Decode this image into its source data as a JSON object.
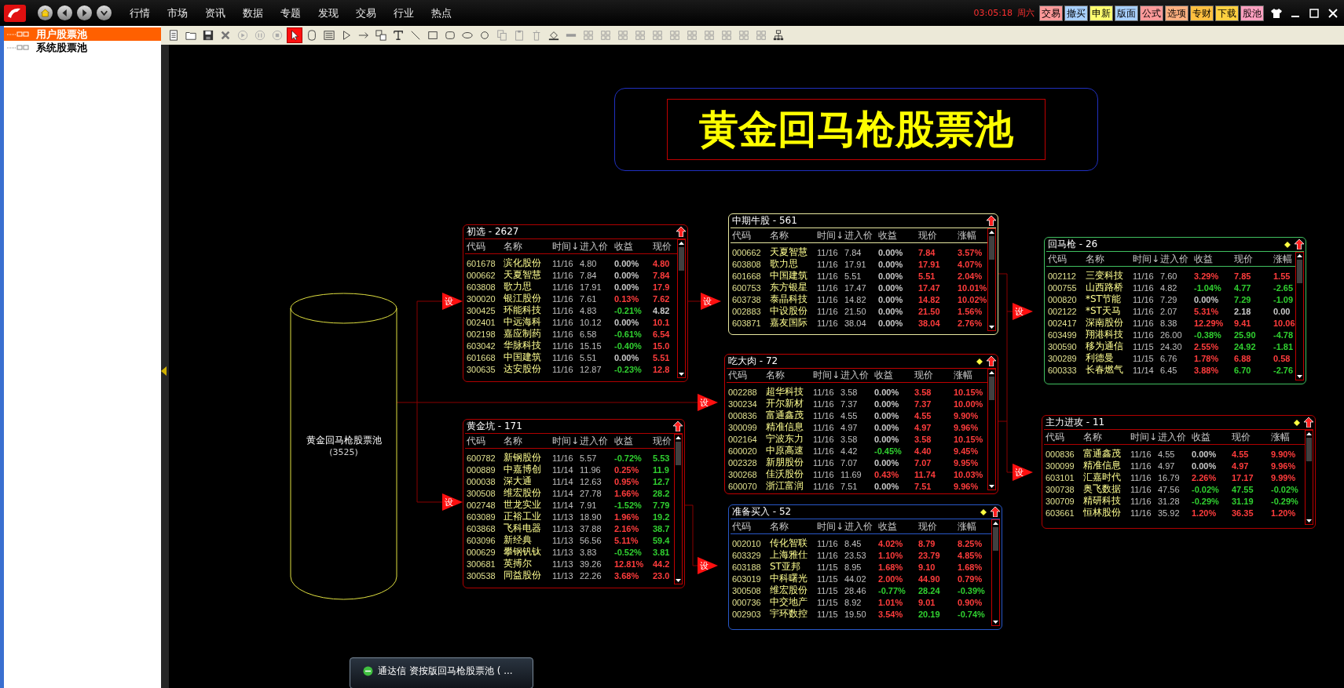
{
  "menu_bar": {
    "items": [
      "行情",
      "市场",
      "资讯",
      "数据",
      "专题",
      "发现",
      "交易",
      "行业",
      "热点"
    ],
    "clock": "03:05:18",
    "weekday": "周六",
    "buttons": [
      {
        "label": "交易",
        "color": "#ff9a9a"
      },
      {
        "label": "撤买",
        "color": "#a8d0ff"
      },
      {
        "label": "申新",
        "color": "#ffff70"
      },
      {
        "label": "版面",
        "color": "#a8d0ff"
      },
      {
        "label": "公式",
        "color": "#ff9a9a"
      },
      {
        "label": "选项",
        "color": "#ffb080"
      },
      {
        "label": "专财",
        "color": "#ffc040"
      },
      {
        "label": "下载",
        "color": "#ffd040"
      },
      {
        "label": "股池",
        "color": "#ffa0c0"
      }
    ]
  },
  "sidebar": {
    "items": [
      {
        "label": "用户股票池",
        "selected": true
      },
      {
        "label": "系统股票池",
        "selected": false
      }
    ]
  },
  "toolbar": [
    {
      "kind": "page",
      "selected": false
    },
    {
      "kind": "folder",
      "selected": false
    },
    {
      "kind": "save",
      "selected": false
    },
    {
      "kind": "delete",
      "selected": false
    },
    {
      "kind": "play",
      "selected": false
    },
    {
      "kind": "pause",
      "selected": false
    },
    {
      "kind": "stop",
      "selected": false
    },
    {
      "kind": "pointer",
      "selected": true
    },
    {
      "kind": "rounded-box",
      "selected": false
    },
    {
      "kind": "list",
      "selected": false
    },
    {
      "kind": "triangle",
      "selected": false
    },
    {
      "kind": "arrow",
      "selected": false
    },
    {
      "kind": "group",
      "selected": false
    },
    {
      "kind": "text",
      "selected": false
    },
    {
      "kind": "line",
      "selected": false
    },
    {
      "kind": "rect",
      "selected": false
    },
    {
      "kind": "rounded-rect",
      "selected": false
    },
    {
      "kind": "ellipse",
      "selected": false
    },
    {
      "kind": "circle",
      "selected": false
    },
    {
      "kind": "copy",
      "selected": false
    },
    {
      "kind": "paste",
      "selected": false
    },
    {
      "kind": "trash",
      "selected": false
    },
    {
      "kind": "fill",
      "selected": false
    },
    {
      "kind": "bar",
      "selected": false
    },
    {
      "kind": "align",
      "selected": false
    },
    {
      "kind": "align",
      "selected": false
    },
    {
      "kind": "align",
      "selected": false
    },
    {
      "kind": "align",
      "selected": false
    },
    {
      "kind": "align",
      "selected": false
    },
    {
      "kind": "align",
      "selected": false
    },
    {
      "kind": "align",
      "selected": false
    },
    {
      "kind": "align",
      "selected": false
    },
    {
      "kind": "align",
      "selected": false
    },
    {
      "kind": "align",
      "selected": false
    },
    {
      "kind": "align",
      "selected": false
    },
    {
      "kind": "tree",
      "selected": false
    }
  ],
  "diagram": {
    "title": "黄金回马枪股票池",
    "source": {
      "name": "黄金回马枪股票池",
      "count": "(3525)"
    },
    "links": [
      {
        "label": "设"
      },
      {
        "label": "设"
      },
      {
        "label": "设"
      },
      {
        "label": "设"
      },
      {
        "label": "设"
      },
      {
        "label": "设"
      },
      {
        "label": "设"
      }
    ],
    "pools": [
      {
        "title": "初选 - 2627",
        "color": "#b00000",
        "marked": false,
        "columns": [
          "代码",
          "名称",
          "时间↓",
          "进入价",
          "收益",
          "现价"
        ],
        "rows": [
          {
            "code": "601678",
            "name": "滨化股份",
            "time": "11/16",
            "entry": "4.80",
            "gain": {
              "value": "0.00%",
              "color": "#c8c8c8"
            },
            "price": {
              "value": "4.80",
              "color": "#ff3c3c"
            }
          },
          {
            "code": "000662",
            "name": "天夏智慧",
            "time": "11/16",
            "entry": "7.84",
            "gain": {
              "value": "0.00%",
              "color": "#c8c8c8"
            },
            "price": {
              "value": "7.84",
              "color": "#ff3c3c"
            }
          },
          {
            "code": "603808",
            "name": "歌力思",
            "time": "11/16",
            "entry": "17.91",
            "gain": {
              "value": "0.00%",
              "color": "#c8c8c8"
            },
            "price": {
              "value": "17.9",
              "color": "#ff3c3c"
            }
          },
          {
            "code": "300020",
            "name": "银江股份",
            "time": "11/16",
            "entry": "7.61",
            "gain": {
              "value": "0.13%",
              "color": "#ff3c3c"
            },
            "price": {
              "value": "7.62",
              "color": "#ff3c3c"
            }
          },
          {
            "code": "300425",
            "name": "环能科技",
            "time": "11/16",
            "entry": "4.83",
            "gain": {
              "value": "-0.21%",
              "color": "#30d030"
            },
            "price": {
              "value": "4.82",
              "color": "#c8c8c8"
            }
          },
          {
            "code": "002401",
            "name": "中远海科",
            "time": "11/16",
            "entry": "10.12",
            "gain": {
              "value": "0.00%",
              "color": "#c8c8c8"
            },
            "price": {
              "value": "10.1",
              "color": "#ff3c3c"
            }
          },
          {
            "code": "002198",
            "name": "嘉应制药",
            "time": "11/16",
            "entry": "6.58",
            "gain": {
              "value": "-0.61%",
              "color": "#30d030"
            },
            "price": {
              "value": "6.54",
              "color": "#ff3c3c"
            }
          },
          {
            "code": "603042",
            "name": "华脉科技",
            "time": "11/16",
            "entry": "15.15",
            "gain": {
              "value": "-0.40%",
              "color": "#30d030"
            },
            "price": {
              "value": "15.0",
              "color": "#ff3c3c"
            }
          },
          {
            "code": "601668",
            "name": "中国建筑",
            "time": "11/16",
            "entry": "5.51",
            "gain": {
              "value": "0.00%",
              "color": "#c8c8c8"
            },
            "price": {
              "value": "5.51",
              "color": "#ff3c3c"
            }
          },
          {
            "code": "300635",
            "name": "达安股份",
            "time": "11/16",
            "entry": "12.87",
            "gain": {
              "value": "-0.23%",
              "color": "#30d030"
            },
            "price": {
              "value": "12.8",
              "color": "#ff3c3c"
            }
          }
        ]
      },
      {
        "title": "黄金坑 - 171",
        "color": "#b00000",
        "marked": false,
        "columns": [
          "代码",
          "名称",
          "时间↓",
          "进入价",
          "收益",
          "现价"
        ],
        "rows": [
          {
            "code": "600782",
            "name": "新钢股份",
            "time": "11/16",
            "entry": "5.57",
            "gain": {
              "value": "-0.72%",
              "color": "#30d030"
            },
            "price": {
              "value": "5.53",
              "color": "#30d030"
            }
          },
          {
            "code": "000889",
            "name": "中嘉博创",
            "time": "11/14",
            "entry": "11.96",
            "gain": {
              "value": "0.25%",
              "color": "#ff3c3c"
            },
            "price": {
              "value": "11.9",
              "color": "#30d030"
            }
          },
          {
            "code": "000038",
            "name": "深大通",
            "time": "11/14",
            "entry": "12.63",
            "gain": {
              "value": "0.95%",
              "color": "#ff3c3c"
            },
            "price": {
              "value": "12.7",
              "color": "#30d030"
            }
          },
          {
            "code": "300508",
            "name": "维宏股份",
            "time": "11/14",
            "entry": "27.78",
            "gain": {
              "value": "1.66%",
              "color": "#ff3c3c"
            },
            "price": {
              "value": "28.2",
              "color": "#30d030"
            }
          },
          {
            "code": "002748",
            "name": "世龙实业",
            "time": "11/14",
            "entry": "7.91",
            "gain": {
              "value": "-1.52%",
              "color": "#30d030"
            },
            "price": {
              "value": "7.79",
              "color": "#30d030"
            }
          },
          {
            "code": "603089",
            "name": "正裕工业",
            "time": "11/13",
            "entry": "18.90",
            "gain": {
              "value": "1.96%",
              "color": "#ff3c3c"
            },
            "price": {
              "value": "19.2",
              "color": "#30d030"
            }
          },
          {
            "code": "603868",
            "name": "飞科电器",
            "time": "11/13",
            "entry": "37.88",
            "gain": {
              "value": "2.16%",
              "color": "#ff3c3c"
            },
            "price": {
              "value": "38.7",
              "color": "#30d030"
            }
          },
          {
            "code": "603096",
            "name": "新经典",
            "time": "11/13",
            "entry": "56.56",
            "gain": {
              "value": "5.11%",
              "color": "#ff3c3c"
            },
            "price": {
              "value": "59.4",
              "color": "#30d030"
            }
          },
          {
            "code": "000629",
            "name": "攀钢钒钛",
            "time": "11/13",
            "entry": "3.83",
            "gain": {
              "value": "-0.52%",
              "color": "#30d030"
            },
            "price": {
              "value": "3.81",
              "color": "#30d030"
            }
          },
          {
            "code": "300681",
            "name": "英搏尔",
            "time": "11/13",
            "entry": "39.26",
            "gain": {
              "value": "12.81%",
              "color": "#ff3c3c"
            },
            "price": {
              "value": "44.2",
              "color": "#ff3c3c"
            }
          },
          {
            "code": "300538",
            "name": "同益股份",
            "time": "11/13",
            "entry": "22.26",
            "gain": {
              "value": "3.68%",
              "color": "#ff3c3c"
            },
            "price": {
              "value": "23.0",
              "color": "#ff3c3c"
            }
          }
        ]
      },
      {
        "title": "中期牛股 - 561",
        "color": "#e8e8a0",
        "marked": false,
        "columns": [
          "代码",
          "名称",
          "时间↓",
          "进入价",
          "收益",
          "现价",
          "涨幅"
        ],
        "rows": [
          {
            "code": "000662",
            "name": "天夏智慧",
            "time": "11/16",
            "entry": "7.84",
            "gain": {
              "value": "0.00%",
              "color": "#c8c8c8"
            },
            "price": {
              "value": "7.84",
              "color": "#ff3c3c"
            },
            "change": {
              "value": "3.57%",
              "color": "#ff3c3c"
            }
          },
          {
            "code": "603808",
            "name": "歌力思",
            "time": "11/16",
            "entry": "17.91",
            "gain": {
              "value": "0.00%",
              "color": "#c8c8c8"
            },
            "price": {
              "value": "17.91",
              "color": "#ff3c3c"
            },
            "change": {
              "value": "4.07%",
              "color": "#ff3c3c"
            }
          },
          {
            "code": "601668",
            "name": "中国建筑",
            "time": "11/16",
            "entry": "5.51",
            "gain": {
              "value": "0.00%",
              "color": "#c8c8c8"
            },
            "price": {
              "value": "5.51",
              "color": "#ff3c3c"
            },
            "change": {
              "value": "2.04%",
              "color": "#ff3c3c"
            }
          },
          {
            "code": "600753",
            "name": "东方银星",
            "time": "11/16",
            "entry": "17.47",
            "gain": {
              "value": "0.00%",
              "color": "#c8c8c8"
            },
            "price": {
              "value": "17.47",
              "color": "#ff3c3c"
            },
            "change": {
              "value": "10.01%",
              "color": "#ff3c3c"
            }
          },
          {
            "code": "603738",
            "name": "泰晶科技",
            "time": "11/16",
            "entry": "14.82",
            "gain": {
              "value": "0.00%",
              "color": "#c8c8c8"
            },
            "price": {
              "value": "14.82",
              "color": "#ff3c3c"
            },
            "change": {
              "value": "10.02%",
              "color": "#ff3c3c"
            }
          },
          {
            "code": "002883",
            "name": "中设股份",
            "time": "11/16",
            "entry": "21.50",
            "gain": {
              "value": "0.00%",
              "color": "#c8c8c8"
            },
            "price": {
              "value": "21.50",
              "color": "#ff3c3c"
            },
            "change": {
              "value": "1.56%",
              "color": "#ff3c3c"
            }
          },
          {
            "code": "603871",
            "name": "嘉友国际",
            "time": "11/16",
            "entry": "38.04",
            "gain": {
              "value": "0.00%",
              "color": "#c8c8c8"
            },
            "price": {
              "value": "38.04",
              "color": "#ff3c3c"
            },
            "change": {
              "value": "2.76%",
              "color": "#ff3c3c"
            }
          }
        ]
      },
      {
        "title": "吃大肉 - 72",
        "color": "#c00000",
        "marked": true,
        "columns": [
          "代码",
          "名称",
          "时间↓",
          "进入价",
          "收益",
          "现价",
          "涨幅"
        ],
        "rows": [
          {
            "code": "002288",
            "name": "超华科技",
            "time": "11/16",
            "entry": "3.58",
            "gain": {
              "value": "0.00%",
              "color": "#c8c8c8"
            },
            "price": {
              "value": "3.58",
              "color": "#ff3c3c"
            },
            "change": {
              "value": "10.15%",
              "color": "#ff3c3c"
            }
          },
          {
            "code": "300234",
            "name": "开尔新材",
            "time": "11/16",
            "entry": "7.37",
            "gain": {
              "value": "0.00%",
              "color": "#c8c8c8"
            },
            "price": {
              "value": "7.37",
              "color": "#ff3c3c"
            },
            "change": {
              "value": "10.00%",
              "color": "#ff3c3c"
            }
          },
          {
            "code": "000836",
            "name": "富通鑫茂",
            "time": "11/16",
            "entry": "4.55",
            "gain": {
              "value": "0.00%",
              "color": "#c8c8c8"
            },
            "price": {
              "value": "4.55",
              "color": "#ff3c3c"
            },
            "change": {
              "value": "9.90%",
              "color": "#ff3c3c"
            }
          },
          {
            "code": "300099",
            "name": "精准信息",
            "time": "11/16",
            "entry": "4.97",
            "gain": {
              "value": "0.00%",
              "color": "#c8c8c8"
            },
            "price": {
              "value": "4.97",
              "color": "#ff3c3c"
            },
            "change": {
              "value": "9.96%",
              "color": "#ff3c3c"
            }
          },
          {
            "code": "002164",
            "name": "宁波东力",
            "time": "11/16",
            "entry": "3.58",
            "gain": {
              "value": "0.00%",
              "color": "#c8c8c8"
            },
            "price": {
              "value": "3.58",
              "color": "#ff3c3c"
            },
            "change": {
              "value": "10.15%",
              "color": "#ff3c3c"
            }
          },
          {
            "code": "600020",
            "name": "中原高速",
            "time": "11/16",
            "entry": "4.42",
            "gain": {
              "value": "-0.45%",
              "color": "#30d030"
            },
            "price": {
              "value": "4.40",
              "color": "#ff3c3c"
            },
            "change": {
              "value": "9.45%",
              "color": "#ff3c3c"
            }
          },
          {
            "code": "002328",
            "name": "新朋股份",
            "time": "11/16",
            "entry": "7.07",
            "gain": {
              "value": "0.00%",
              "color": "#c8c8c8"
            },
            "price": {
              "value": "7.07",
              "color": "#ff3c3c"
            },
            "change": {
              "value": "9.95%",
              "color": "#ff3c3c"
            }
          },
          {
            "code": "300268",
            "name": "佳沃股份",
            "time": "11/16",
            "entry": "11.69",
            "gain": {
              "value": "0.43%",
              "color": "#ff3c3c"
            },
            "price": {
              "value": "11.74",
              "color": "#ff3c3c"
            },
            "change": {
              "value": "10.03%",
              "color": "#ff3c3c"
            }
          },
          {
            "code": "600070",
            "name": "浙江富润",
            "time": "11/16",
            "entry": "7.51",
            "gain": {
              "value": "0.00%",
              "color": "#c8c8c8"
            },
            "price": {
              "value": "7.51",
              "color": "#ff3c3c"
            },
            "change": {
              "value": "9.96%",
              "color": "#ff3c3c"
            }
          }
        ]
      },
      {
        "title": "准备买入 - 52",
        "color": "#2858c8",
        "marked": true,
        "columns": [
          "代码",
          "名称",
          "时间↓",
          "进入价",
          "收益",
          "现价",
          "涨幅"
        ],
        "rows": [
          {
            "code": "002010",
            "name": "传化智联",
            "time": "11/16",
            "entry": "8.45",
            "gain": {
              "value": "4.02%",
              "color": "#ff3c3c"
            },
            "price": {
              "value": "8.79",
              "color": "#ff3c3c"
            },
            "change": {
              "value": "8.25%",
              "color": "#ff3c3c"
            }
          },
          {
            "code": "603329",
            "name": "上海雅仕",
            "time": "11/16",
            "entry": "23.53",
            "gain": {
              "value": "1.10%",
              "color": "#ff3c3c"
            },
            "price": {
              "value": "23.79",
              "color": "#ff3c3c"
            },
            "change": {
              "value": "4.85%",
              "color": "#ff3c3c"
            }
          },
          {
            "code": "603188",
            "name": "ST亚邦",
            "time": "11/15",
            "entry": "8.95",
            "gain": {
              "value": "1.68%",
              "color": "#ff3c3c"
            },
            "price": {
              "value": "9.10",
              "color": "#ff3c3c"
            },
            "change": {
              "value": "1.68%",
              "color": "#ff3c3c"
            }
          },
          {
            "code": "603019",
            "name": "中科曙光",
            "time": "11/15",
            "entry": "44.02",
            "gain": {
              "value": "2.00%",
              "color": "#ff3c3c"
            },
            "price": {
              "value": "44.90",
              "color": "#ff3c3c"
            },
            "change": {
              "value": "0.79%",
              "color": "#ff3c3c"
            }
          },
          {
            "code": "300508",
            "name": "维宏股份",
            "time": "11/15",
            "entry": "28.46",
            "gain": {
              "value": "-0.77%",
              "color": "#30d030"
            },
            "price": {
              "value": "28.24",
              "color": "#30d030"
            },
            "change": {
              "value": "-0.39%",
              "color": "#30d030"
            }
          },
          {
            "code": "000736",
            "name": "中交地产",
            "time": "11/15",
            "entry": "8.92",
            "gain": {
              "value": "1.01%",
              "color": "#ff3c3c"
            },
            "price": {
              "value": "9.01",
              "color": "#ff3c3c"
            },
            "change": {
              "value": "0.90%",
              "color": "#ff3c3c"
            }
          },
          {
            "code": "002903",
            "name": "宇环数控",
            "time": "11/15",
            "entry": "19.50",
            "gain": {
              "value": "3.54%",
              "color": "#ff3c3c"
            },
            "price": {
              "value": "20.19",
              "color": "#30d030"
            },
            "change": {
              "value": "-0.74%",
              "color": "#30d030"
            }
          }
        ]
      },
      {
        "title": "回马枪 - 26",
        "color": "#40c060",
        "marked": true,
        "columns": [
          "代码",
          "名称",
          "时间↓",
          "进入价",
          "收益",
          "现价",
          "涨幅"
        ],
        "rows": [
          {
            "code": "002112",
            "name": "三变科技",
            "time": "11/16",
            "entry": "7.60",
            "gain": {
              "value": "3.29%",
              "color": "#ff3c3c"
            },
            "price": {
              "value": "7.85",
              "color": "#ff3c3c"
            },
            "change": {
              "value": "1.55",
              "color": "#ff3c3c"
            }
          },
          {
            "code": "000755",
            "name": "山西路桥",
            "time": "11/16",
            "entry": "4.82",
            "gain": {
              "value": "-1.04%",
              "color": "#30d030"
            },
            "price": {
              "value": "4.77",
              "color": "#30d030"
            },
            "change": {
              "value": "-2.65",
              "color": "#30d030"
            }
          },
          {
            "code": "000820",
            "name": "*ST节能",
            "time": "11/16",
            "entry": "7.29",
            "gain": {
              "value": "0.00%",
              "color": "#c8c8c8"
            },
            "price": {
              "value": "7.29",
              "color": "#30d030"
            },
            "change": {
              "value": "-1.09",
              "color": "#30d030"
            }
          },
          {
            "code": "002122",
            "name": "*ST天马",
            "time": "11/16",
            "entry": "2.07",
            "gain": {
              "value": "5.31%",
              "color": "#ff3c3c"
            },
            "price": {
              "value": "2.18",
              "color": "#c8c8c8"
            },
            "change": {
              "value": "0.00",
              "color": "#c8c8c8"
            }
          },
          {
            "code": "002417",
            "name": "深南股份",
            "time": "11/16",
            "entry": "8.38",
            "gain": {
              "value": "12.29%",
              "color": "#ff3c3c"
            },
            "price": {
              "value": "9.41",
              "color": "#ff3c3c"
            },
            "change": {
              "value": "10.06",
              "color": "#ff3c3c"
            }
          },
          {
            "code": "603499",
            "name": "翔港科技",
            "time": "11/16",
            "entry": "26.00",
            "gain": {
              "value": "-0.38%",
              "color": "#30d030"
            },
            "price": {
              "value": "25.90",
              "color": "#30d030"
            },
            "change": {
              "value": "-4.78",
              "color": "#30d030"
            }
          },
          {
            "code": "300590",
            "name": "移为通信",
            "time": "11/15",
            "entry": "24.30",
            "gain": {
              "value": "2.55%",
              "color": "#ff3c3c"
            },
            "price": {
              "value": "24.92",
              "color": "#30d030"
            },
            "change": {
              "value": "-1.81",
              "color": "#30d030"
            }
          },
          {
            "code": "300289",
            "name": "利德曼",
            "time": "11/15",
            "entry": "6.76",
            "gain": {
              "value": "1.78%",
              "color": "#ff3c3c"
            },
            "price": {
              "value": "6.88",
              "color": "#ff3c3c"
            },
            "change": {
              "value": "0.58",
              "color": "#ff3c3c"
            }
          },
          {
            "code": "600333",
            "name": "长春燃气",
            "time": "11/14",
            "entry": "6.45",
            "gain": {
              "value": "3.88%",
              "color": "#ff3c3c"
            },
            "price": {
              "value": "6.70",
              "color": "#30d030"
            },
            "change": {
              "value": "-2.76",
              "color": "#30d030"
            }
          }
        ]
      },
      {
        "title": "主力进攻 - 11",
        "color": "#b00000",
        "marked": true,
        "columns": [
          "代码",
          "名称",
          "时间↓",
          "进入价",
          "收益",
          "现价",
          "涨幅"
        ],
        "rows": [
          {
            "code": "000836",
            "name": "富通鑫茂",
            "time": "11/16",
            "entry": "4.55",
            "gain": {
              "value": "0.00%",
              "color": "#c8c8c8"
            },
            "price": {
              "value": "4.55",
              "color": "#ff3c3c"
            },
            "change": {
              "value": "9.90%",
              "color": "#ff3c3c"
            }
          },
          {
            "code": "300099",
            "name": "精准信息",
            "time": "11/16",
            "entry": "4.97",
            "gain": {
              "value": "0.00%",
              "color": "#c8c8c8"
            },
            "price": {
              "value": "4.97",
              "color": "#ff3c3c"
            },
            "change": {
              "value": "9.96%",
              "color": "#ff3c3c"
            }
          },
          {
            "code": "603101",
            "name": "汇嘉时代",
            "time": "11/16",
            "entry": "16.79",
            "gain": {
              "value": "2.26%",
              "color": "#ff3c3c"
            },
            "price": {
              "value": "17.17",
              "color": "#ff3c3c"
            },
            "change": {
              "value": "9.99%",
              "color": "#ff3c3c"
            }
          },
          {
            "code": "300738",
            "name": "奥飞数据",
            "time": "11/16",
            "entry": "47.56",
            "gain": {
              "value": "-0.02%",
              "color": "#30d030"
            },
            "price": {
              "value": "47.55",
              "color": "#30d030"
            },
            "change": {
              "value": "-0.02%",
              "color": "#30d030"
            }
          },
          {
            "code": "300709",
            "name": "精研科技",
            "time": "11/16",
            "entry": "31.28",
            "gain": {
              "value": "-0.29%",
              "color": "#30d030"
            },
            "price": {
              "value": "31.19",
              "color": "#30d030"
            },
            "change": {
              "value": "-0.29%",
              "color": "#30d030"
            }
          },
          {
            "code": "603661",
            "name": "恒林股份",
            "time": "11/16",
            "entry": "35.92",
            "gain": {
              "value": "1.20%",
              "color": "#ff3c3c"
            },
            "price": {
              "value": "36.35",
              "color": "#ff3c3c"
            },
            "change": {
              "value": "1.20%",
              "color": "#ff3c3c"
            }
          }
        ]
      }
    ]
  },
  "taskbar_item": {
    "label": "通达信 资按版回马枪股票池 ( ..."
  }
}
